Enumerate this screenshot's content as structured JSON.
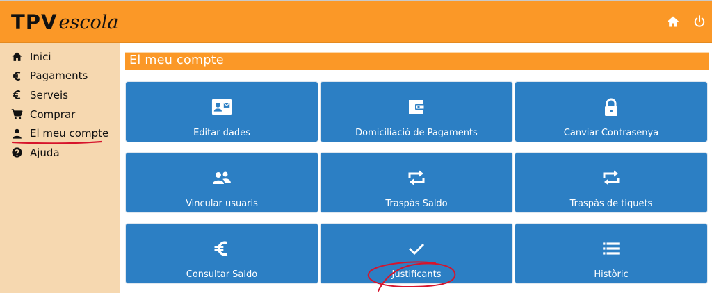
{
  "header": {
    "logo_bold": "TPV",
    "logo_script": "escola",
    "icons": [
      "home-icon",
      "power-icon"
    ]
  },
  "sidebar": {
    "active_index": 4,
    "items": [
      {
        "label": "Inici",
        "icon": "home-icon"
      },
      {
        "label": "Pagaments",
        "icon": "euro-icon"
      },
      {
        "label": "Serveis",
        "icon": "euro-icon"
      },
      {
        "label": "Comprar",
        "icon": "cart-icon"
      },
      {
        "label": "El meu compte",
        "icon": "user-icon"
      },
      {
        "label": "Ajuda",
        "icon": "help-icon"
      }
    ]
  },
  "main": {
    "title": "El meu compte",
    "tiles": [
      {
        "label": "Editar dades",
        "icon": "id-card-icon"
      },
      {
        "label": "Domiciliació de Pagaments",
        "icon": "wallet-icon"
      },
      {
        "label": "Canviar Contrasenya",
        "icon": "lock-icon"
      },
      {
        "label": "Vincular usuaris",
        "icon": "users-icon"
      },
      {
        "label": "Traspàs Saldo",
        "icon": "transfer-icon"
      },
      {
        "label": "Traspàs de tiquets",
        "icon": "transfer-icon"
      },
      {
        "label": "Consultar Saldo",
        "icon": "euro-icon"
      },
      {
        "label": "Justificants",
        "icon": "check-icon"
      },
      {
        "label": "Històric",
        "icon": "list-icon"
      }
    ]
  },
  "colors": {
    "header": "#fb9827",
    "sidebar": "#f6d8b0",
    "tile": "#2c7fc4",
    "annotation": "#d6142c"
  }
}
